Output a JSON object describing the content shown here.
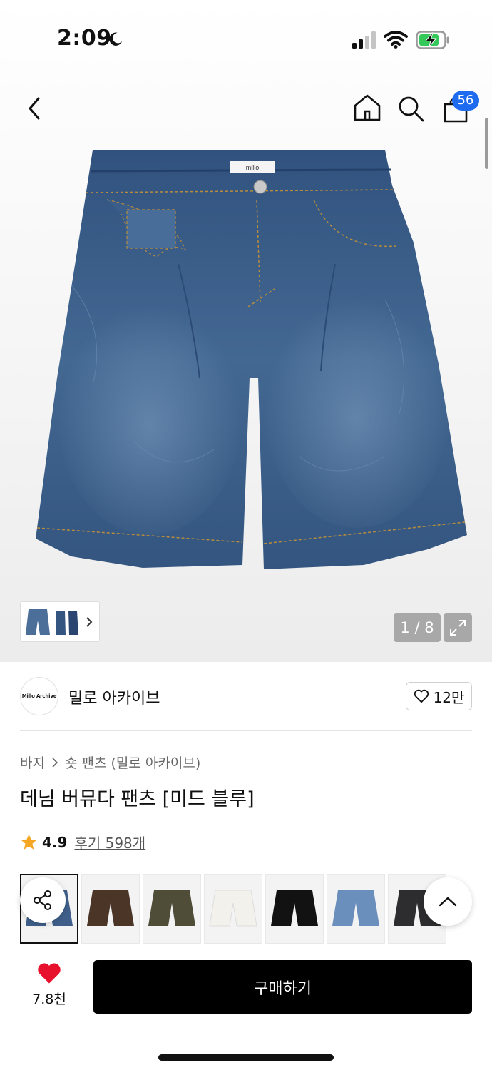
{
  "status_bar": {
    "time": "2:09",
    "icons": [
      "moon-icon",
      "signal-icon",
      "wifi-icon",
      "battery-charging-icon"
    ]
  },
  "nav": {
    "icons": [
      "back-icon",
      "home-icon",
      "search-icon",
      "shopping-bag-icon"
    ],
    "cart_count": "56"
  },
  "gallery": {
    "counter": "1 / 8",
    "waistband_label": "millo"
  },
  "brand": {
    "logo_text": "Millo Archive",
    "name": "밀로 아카이브",
    "likes": "12만"
  },
  "breadcrumb": {
    "category": "바지",
    "subcategory": "숏 팬츠 (밀로 아카이브)"
  },
  "product": {
    "title": "데님 버뮤다 팬츠 [미드 블루]",
    "rating": "4.9",
    "reviews": "후기 598개"
  },
  "color_options": [
    {
      "color": "#3f5f8a",
      "selected": true
    },
    {
      "color": "#4a3526"
    },
    {
      "color": "#4f4c38"
    },
    {
      "color": "#f2f1ec"
    },
    {
      "color": "#121212"
    },
    {
      "color": "#6b8fbd"
    },
    {
      "color": "#2d2d2f"
    }
  ],
  "bottom_bar": {
    "wish_count": "7.8천",
    "buy_label": "구매하기"
  },
  "colors": {
    "accent": "#1f6bf0",
    "star": "#f5a623",
    "heart": "#e8112d",
    "buy": "#000000"
  }
}
